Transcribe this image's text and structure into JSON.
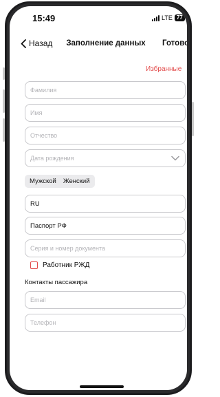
{
  "status_bar": {
    "time": "15:49",
    "network": "LTE",
    "battery": "77"
  },
  "nav": {
    "back_label": "Назад",
    "title": "Заполнение данных",
    "done_label": "Готово"
  },
  "favorites_label": "Избранные",
  "fields": {
    "last_name": {
      "placeholder": "Фамилия"
    },
    "first_name": {
      "placeholder": "Имя"
    },
    "patronymic": {
      "placeholder": "Отчество"
    },
    "birth_date": {
      "placeholder": "Дата рождения"
    },
    "citizenship": {
      "value": "RU"
    },
    "document_type": {
      "value": "Паспорт РФ"
    },
    "document_number": {
      "placeholder": "Серия и номер документа"
    },
    "email": {
      "placeholder": "Email"
    },
    "phone": {
      "placeholder": "Телефон"
    }
  },
  "gender": {
    "options": [
      "Мужской",
      "Женский"
    ]
  },
  "rzd_employee": {
    "label": "Работник РЖД",
    "checked": false
  },
  "contacts_section_title": "Контакты пассажира",
  "colors": {
    "accent": "#e24b4b",
    "border": "#c8c8cc",
    "placeholder": "#b4b4b8"
  },
  "icons": [
    "back-chevron-icon",
    "chevron-down-icon",
    "signal-icon",
    "battery-icon"
  ]
}
